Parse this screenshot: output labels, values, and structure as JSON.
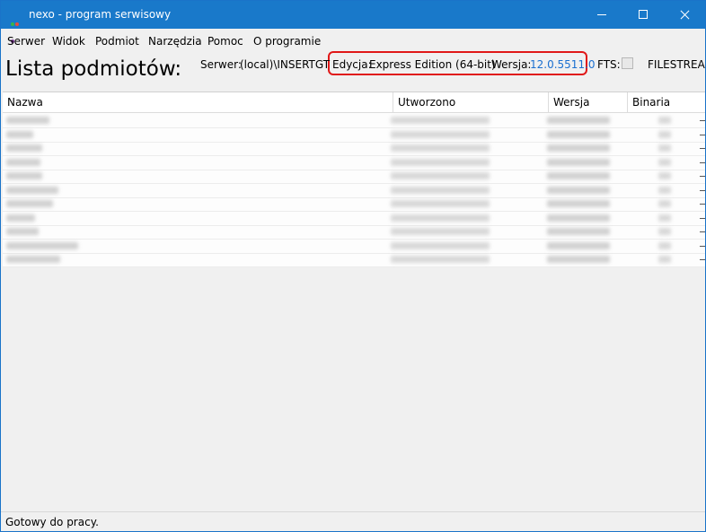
{
  "window": {
    "title": "nexo - program serwisowy"
  },
  "menu": [
    "Serwer",
    "Widok",
    "Podmiot",
    "Narzędzia",
    "Pomoc",
    "O programie"
  ],
  "page": {
    "title": "Lista podmiotów:"
  },
  "info": {
    "server_label": "Serwer:",
    "server_value": "(local)\\INSERTGT",
    "edition_label": "Edycja:",
    "edition_value": "Express Edition (64-bit)",
    "version_label": "Wersja:",
    "version_value": "12.0.5511.0",
    "fts_label": "FTS:",
    "fts_checked": false,
    "filestream_label": "FILESTREAM"
  },
  "table": {
    "columns": [
      "Nazwa",
      "Utworzono",
      "Wersja",
      "Binaria"
    ],
    "row_count": 11
  },
  "status": {
    "text": "Gotowy do pracy."
  },
  "colors": {
    "titlebar": "#1979ca",
    "highlight": "#e01818",
    "version_link": "#1a6fd0"
  }
}
